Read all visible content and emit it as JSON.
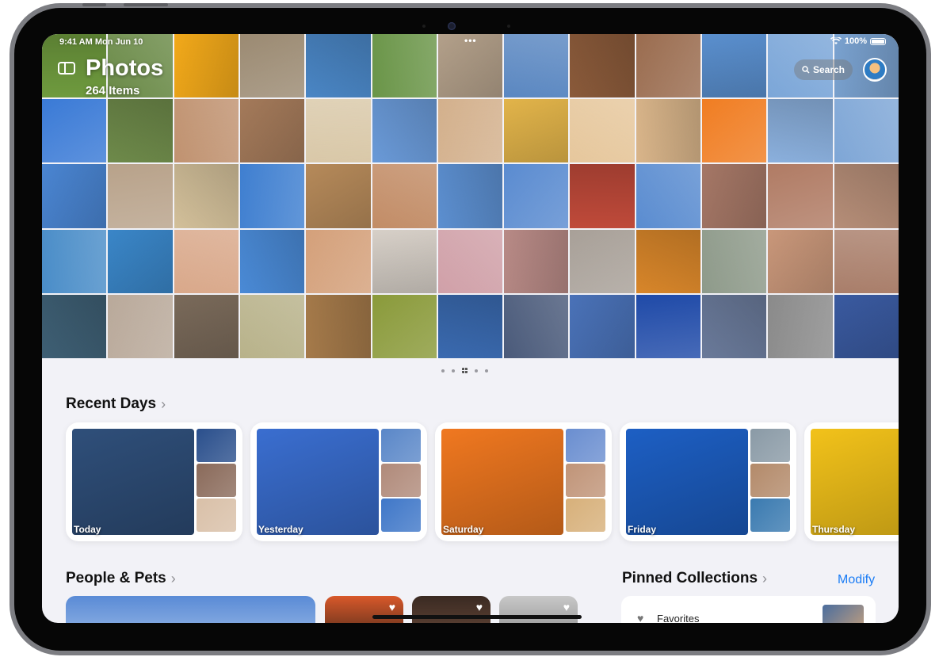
{
  "status_bar": {
    "time": "9:41 AM  Mon Jun 10",
    "dots": "•••",
    "battery": "100%"
  },
  "header": {
    "title": "Photos",
    "item_count": "264 Items",
    "search_label": "Search"
  },
  "colors": {
    "accent": "#1a7cf5",
    "background": "#f2f2f7"
  },
  "grid_photos": [
    "#6f9b3e",
    "#6a8a47",
    "#f2a91a",
    "#9b8a72",
    "#4a86c5",
    "#6a9548",
    "#b3a08a",
    "#5a87c1",
    "#8a5a3a",
    "#9a6c4f",
    "#5a8fce",
    "#7ba6d8",
    "#7aa2d0",
    "#3a7ad6",
    "#6e8a4a",
    "#c09270",
    "#a47a5a",
    "#d9c8a8",
    "#6a9ad8",
    "#d3b08c",
    "#e2b44a",
    "#e6c79c",
    "#d9b58a",
    "#f07d22",
    "#8bb0dd",
    "#7ea6d6",
    "#4a85d2",
    "#b8a28a",
    "#d3c09a",
    "#3f7fd0",
    "#b68a5a",
    "#c28c66",
    "#5c8fd0",
    "#5a8bd0",
    "#c04a3a",
    "#5a8cd0",
    "#a57766",
    "#b07b64",
    "#b68e78",
    "#4a8dc8",
    "#3a86c8",
    "#d9a88a",
    "#4a8ad6",
    "#d4a07a",
    "#d7d0c8",
    "#d0a0a8",
    "#b88a86",
    "#a8a098",
    "#d8862a",
    "#8e9a8a",
    "#c9977a",
    "#a97e6a",
    "#3e5f74",
    "#b9a99a",
    "#7a6a5a",
    "#b8b28a",
    "#a57a4a",
    "#8a9a3a",
    "#3a6ab0",
    "#4a5a7a",
    "#4a72b8",
    "#1f4aa8",
    "#6a7a9a",
    "#8a8a8a",
    "#3a5aa0"
  ],
  "recent_days": {
    "title": "Recent Days",
    "cards": [
      {
        "label": "Today",
        "main": "#2f4f7a",
        "thumbs": [
          "#2a4f8c",
          "#8a6a5a",
          "#d9c0a8"
        ]
      },
      {
        "label": "Yesterday",
        "main": "#3a6ed0",
        "thumbs": [
          "#5a87c8",
          "#b08a7a",
          "#3f77c8"
        ]
      },
      {
        "label": "Saturday",
        "main": "#f07820",
        "thumbs": [
          "#6a8ed0",
          "#c09478",
          "#d7b07a"
        ]
      },
      {
        "label": "Friday",
        "main": "#1d5fc4",
        "thumbs": [
          "#8a9aa6",
          "#b38a6a",
          "#3a7ab0"
        ]
      },
      {
        "label": "Thursday",
        "main": "#f2c21a",
        "thumbs": []
      }
    ]
  },
  "people_pets": {
    "title": "People & Pets"
  },
  "pinned": {
    "title": "Pinned Collections",
    "modify_label": "Modify",
    "favorites_label": "Favorites"
  }
}
